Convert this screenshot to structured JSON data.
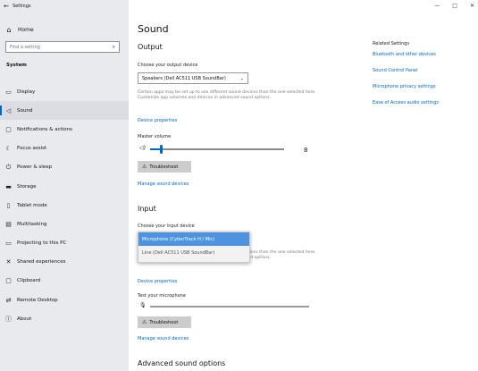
{
  "window": {
    "title": "Settings",
    "controls": [
      "—",
      "□",
      "✕"
    ]
  },
  "sidebar": {
    "home": "Home",
    "search_placeholder": "Find a setting",
    "section": "System",
    "items": [
      {
        "label": "Display",
        "icon": "display-icon",
        "glyph": "▭"
      },
      {
        "label": "Sound",
        "icon": "speaker-icon",
        "glyph": "◁"
      },
      {
        "label": "Notifications & actions",
        "icon": "notifications-icon",
        "glyph": "▢"
      },
      {
        "label": "Focus assist",
        "icon": "moon-icon",
        "glyph": "☾"
      },
      {
        "label": "Power & sleep",
        "icon": "power-icon",
        "glyph": "⏻"
      },
      {
        "label": "Storage",
        "icon": "storage-icon",
        "glyph": "▬"
      },
      {
        "label": "Tablet mode",
        "icon": "tablet-icon",
        "glyph": "▯"
      },
      {
        "label": "Multitasking",
        "icon": "multitasking-icon",
        "glyph": "▤"
      },
      {
        "label": "Projecting to this PC",
        "icon": "projecting-icon",
        "glyph": "▭"
      },
      {
        "label": "Shared experiences",
        "icon": "shared-icon",
        "glyph": "✕"
      },
      {
        "label": "Clipboard",
        "icon": "clipboard-icon",
        "glyph": "▢"
      },
      {
        "label": "Remote Desktop",
        "icon": "remote-desktop-icon",
        "glyph": "⇄"
      },
      {
        "label": "About",
        "icon": "info-icon",
        "glyph": "ⓘ"
      }
    ],
    "active_index": 1,
    "accent": "#0067c0"
  },
  "main": {
    "title": "Sound",
    "output": {
      "heading": "Output",
      "choose_label": "Choose your output device",
      "device": "Speakers (Dell AC511 USB SoundBar)",
      "description": "Certain apps may be set up to use different sound devices than the one selected here. Customize app volumes and devices in advanced sound options.",
      "device_properties": "Device properties",
      "master_volume_label": "Master volume",
      "master_volume_value": "8",
      "master_volume_level": 0.08,
      "troubleshoot": "Troubleshoot",
      "manage": "Manage sound devices"
    },
    "input": {
      "heading": "Input",
      "choose_label": "Choose your input device",
      "options": [
        "Microphone (CyberTrack H / Mic)",
        "Line (Dell AC511 USB SoundBar)"
      ],
      "selected_index": 0,
      "description": "Certain apps may be set up to use different sound devices than the one selected here. Customize app volumes and devices in advanced sound options.",
      "device_properties": "Device properties",
      "test_label": "Test your microphone",
      "troubleshoot": "Troubleshoot",
      "manage": "Manage sound devices"
    },
    "advanced": "Advanced sound options"
  },
  "related": {
    "heading": "Related Settings",
    "links": [
      "Bluetooth and other devices",
      "Sound Control Panel",
      "Microphone privacy settings",
      "Ease of Access audio settings"
    ]
  }
}
